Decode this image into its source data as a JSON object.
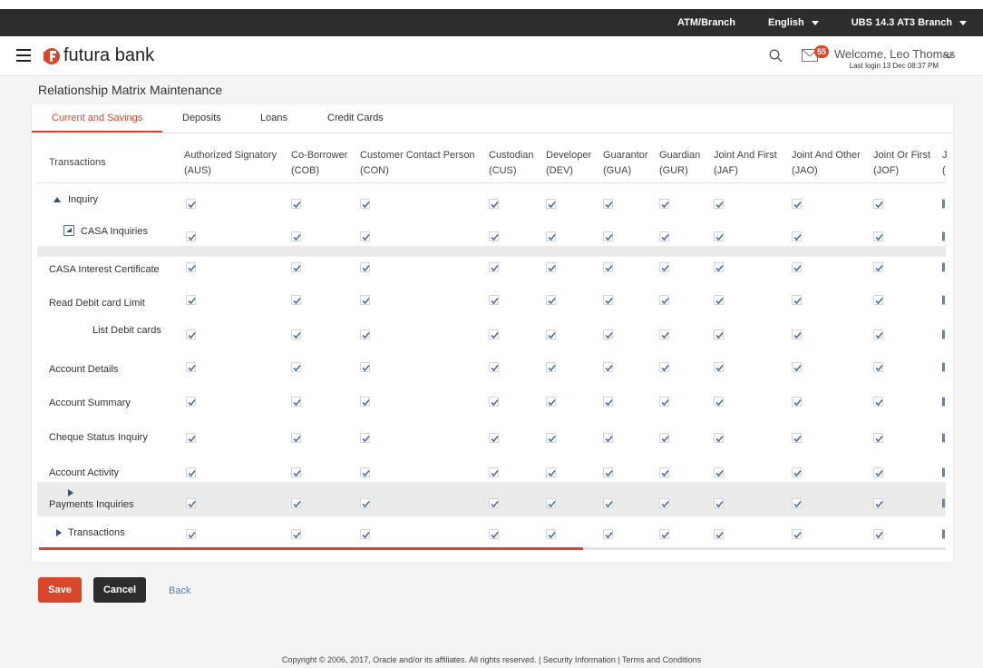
{
  "topbar": {
    "atm_label": "ATM/Branch",
    "language": "English",
    "branch": "UBS 14.3 AT3 Branch"
  },
  "header": {
    "bank_name": "futura bank",
    "notification_count": "55",
    "welcome_text": "Welcome, Leo Thomas",
    "last_login": "Last login 13 Dec 08:37 PM"
  },
  "page": {
    "title": "Relationship Matrix Maintenance"
  },
  "tabs": [
    {
      "label": "Current and Savings",
      "active": true
    },
    {
      "label": "Deposits",
      "active": false
    },
    {
      "label": "Loans",
      "active": false
    },
    {
      "label": "Credit Cards",
      "active": false
    }
  ],
  "table": {
    "first_column_header": "Transactions",
    "columns": [
      {
        "name": "Authorized Signatory",
        "code": "(AUS)"
      },
      {
        "name": "Co-Borrower",
        "code": "(COB)"
      },
      {
        "name": "Customer Contact Person",
        "code": "(CON)"
      },
      {
        "name": "Custodian",
        "code": "(CUS)"
      },
      {
        "name": "Developer",
        "code": "(DEV)"
      },
      {
        "name": "Guarantor",
        "code": "(GUA)"
      },
      {
        "name": "Guardian",
        "code": "(GUR)"
      },
      {
        "name": "Joint And First",
        "code": "(JAF)"
      },
      {
        "name": "Joint And Other",
        "code": "(JAO)"
      },
      {
        "name": "Joint Or First",
        "code": "(JOF)"
      },
      {
        "name": "J",
        "code": "("
      }
    ],
    "rows": [
      {
        "label": "Inquiry",
        "expander": "down"
      },
      {
        "label": "CASA Inquiries",
        "expander": "box"
      },
      {
        "label": "",
        "expander": "none"
      },
      {
        "label": "CASA Interest Certificate",
        "expander": "none"
      },
      {
        "label": "Read Debit card Limit",
        "expander": "none"
      },
      {
        "label": "List Debit cards",
        "expander": "none"
      },
      {
        "label": "Account Details",
        "expander": "none"
      },
      {
        "label": "Account Summary",
        "expander": "none"
      },
      {
        "label": "Cheque Status Inquiry",
        "expander": "none"
      },
      {
        "label": "Account Activity",
        "expander": "none"
      },
      {
        "label": "Payments Inquiries",
        "expander": "right-above"
      },
      {
        "label": "Transactions",
        "expander": "right"
      }
    ],
    "horizontal_scroll_position": 0.6
  },
  "actions": {
    "save_label": "Save",
    "cancel_label": "Cancel",
    "back_label": "Back"
  },
  "footer": {
    "text": "Copyright © 2006, 2017, Oracle and/or its affiliates. All rights reserved. | Security Information | Terms and Conditions"
  },
  "colors": {
    "accent": "#d8472b",
    "topbar": "#2d2d2d",
    "checkbox_check": "#4a6fa5",
    "link": "#5a7bb5"
  },
  "icons": [
    "hamburger-menu-icon",
    "futura-logo-icon",
    "search-icon",
    "mail-icon",
    "chevron-down-icon",
    "check-icon"
  ]
}
